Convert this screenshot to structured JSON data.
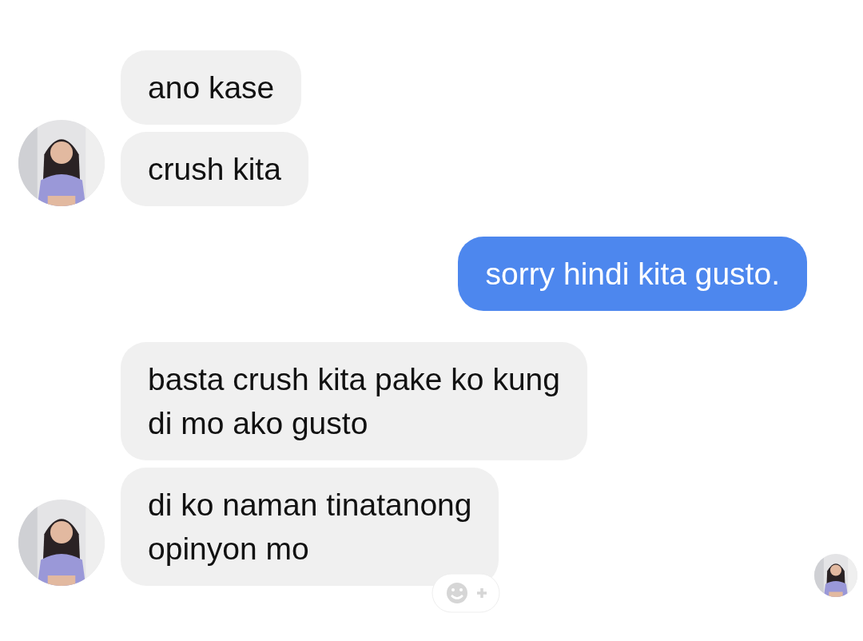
{
  "groups": [
    {
      "kind": "incoming",
      "messages": [
        {
          "text": "ano kase",
          "reaction_button": false
        },
        {
          "text": "crush kita",
          "reaction_button": false
        }
      ]
    },
    {
      "kind": "outgoing",
      "messages": [
        {
          "text": "sorry hindi kita gusto.",
          "reaction_button": false
        }
      ]
    },
    {
      "kind": "incoming",
      "messages": [
        {
          "text": "basta crush kita pake ko kung\ndi mo ako gusto",
          "reaction_button": false
        },
        {
          "text": "di ko naman tinatanong\nopinyon mo",
          "reaction_button": true
        }
      ]
    }
  ]
}
